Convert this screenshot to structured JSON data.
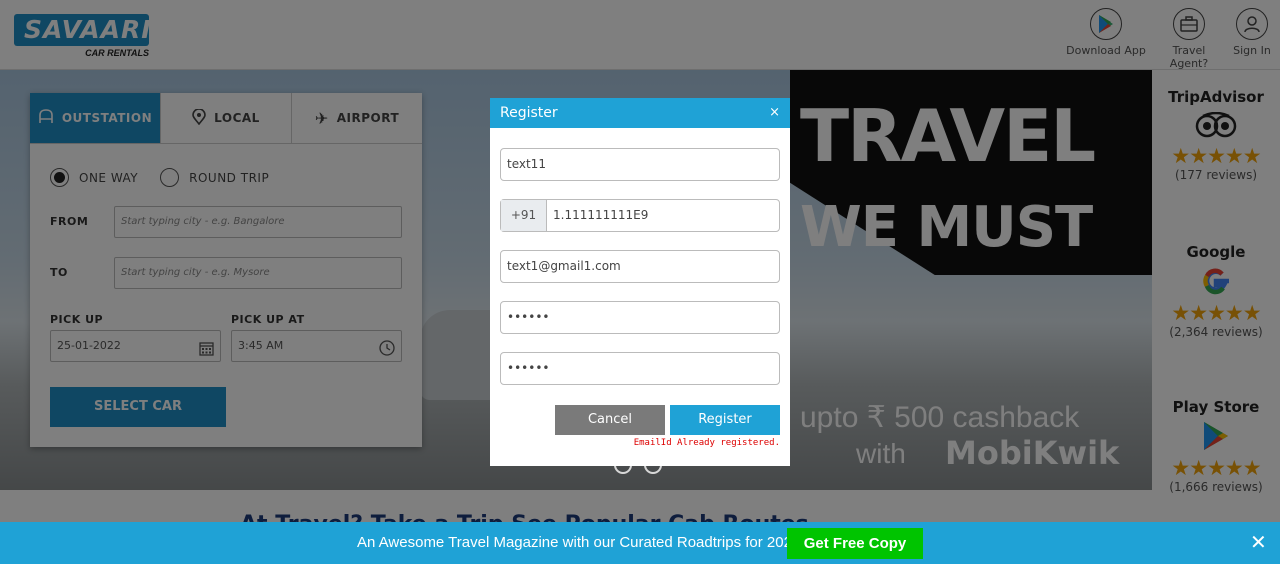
{
  "header": {
    "logo_main": "SAVAARI",
    "logo_sub": "CAR RENTALS",
    "download_app": "Download App",
    "travel_agent": "Travel Agent?",
    "sign_in": "Sign In"
  },
  "hero": {
    "line1": "TRAVEL",
    "line2": "WE MUST",
    "cashback": "upto ₹ 500 cashback",
    "with": "with",
    "brand": "MobiKwik"
  },
  "booking": {
    "tabs": [
      {
        "label": "OUTSTATION",
        "icon": "car-icon",
        "active": true
      },
      {
        "label": "LOCAL",
        "icon": "location-pin-icon",
        "active": false
      },
      {
        "label": "AIRPORT",
        "icon": "airplane-icon",
        "active": false
      }
    ],
    "trip_types": [
      {
        "label": "ONE WAY",
        "selected": true
      },
      {
        "label": "ROUND TRIP",
        "selected": false
      }
    ],
    "from_label": "FROM",
    "from_placeholder": "Start typing city - e.g. Bangalore",
    "to_label": "TO",
    "to_placeholder": "Start typing city - e.g. Mysore",
    "pickup_label": "PICK UP",
    "pickup_date": "25-01-2022",
    "pickup_at_label": "PICK UP AT",
    "pickup_time": "3:45 AM",
    "select_button": "SELECT CAR"
  },
  "reviews": [
    {
      "title": "TripAdvisor",
      "icon": "tripadvisor-owl-icon",
      "rating": 4.5,
      "count": "(177 reviews)"
    },
    {
      "title": "Google",
      "icon": "google-g-icon",
      "rating": 4.5,
      "count": "(2,364 reviews)"
    },
    {
      "title": "Play Store",
      "icon": "play-store-icon",
      "rating": 4.5,
      "count": "(1,666 reviews)"
    }
  ],
  "below": {
    "partial_heading": "At Travel? Take a Trip See Popular Cab Routes"
  },
  "modal": {
    "title": "Register",
    "close": "×",
    "name_value": "text11",
    "phone_prefix": "+91",
    "phone_value": "1.111111111E9",
    "email_value": "text1@gmail1.com",
    "password_value": "••••••",
    "confirm_value": "••••••",
    "cancel_label": "Cancel",
    "register_label": "Register",
    "error_message": "EmailId Already registered."
  },
  "footer": {
    "message": "An Awesome Travel Magazine with our Curated Roadtrips for 2022",
    "button": "Get Free Copy",
    "close": "✕"
  },
  "colors": {
    "brand_blue": "#1f8fc6",
    "modal_header": "#1fa2d6",
    "cta_green": "#00c400",
    "error_red": "#dd0000",
    "star": "#f0a30a"
  }
}
